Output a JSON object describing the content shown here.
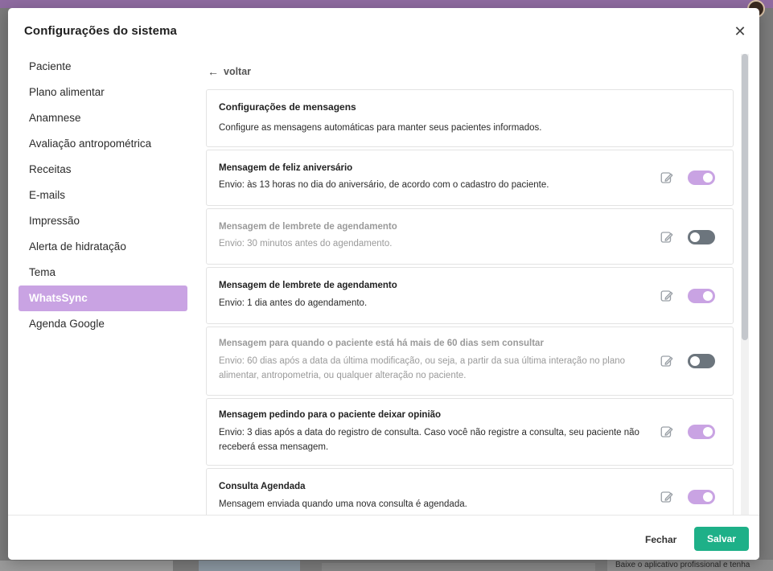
{
  "modal": {
    "title": "Configurações do sistema",
    "close_symbol": "✕"
  },
  "sidebar": {
    "items": [
      {
        "label": "Paciente"
      },
      {
        "label": "Plano alimentar"
      },
      {
        "label": "Anamnese"
      },
      {
        "label": "Avaliação antropométrica"
      },
      {
        "label": "Receitas"
      },
      {
        "label": "E-mails"
      },
      {
        "label": "Impressão"
      },
      {
        "label": "Alerta de hidratação"
      },
      {
        "label": "Tema"
      },
      {
        "label": "WhatsSync"
      },
      {
        "label": "Agenda Google"
      }
    ],
    "active_index": 9
  },
  "content": {
    "back_label": "voltar",
    "intro": {
      "title": "Configurações de mensagens",
      "description": "Configure as mensagens automáticas para manter seus pacientes informados."
    },
    "messages": [
      {
        "title": "Mensagem de feliz aniversário",
        "description": "Envio: às 13 horas no dia do aniversário, de acordo com o cadastro do paciente.",
        "enabled": true
      },
      {
        "title": "Mensagem de lembrete de agendamento",
        "description": "Envio: 30 minutos antes do agendamento.",
        "enabled": false
      },
      {
        "title": "Mensagem de lembrete de agendamento",
        "description": "Envio: 1 dia antes do agendamento.",
        "enabled": true
      },
      {
        "title": "Mensagem para quando o paciente está há mais de 60 dias sem consultar",
        "description": "Envio: 60 dias após a data da última modificação, ou seja, a partir da sua última interação no plano alimentar, antropometria, ou qualquer alteração no paciente.",
        "enabled": false
      },
      {
        "title": "Mensagem pedindo para o paciente deixar opinião",
        "description": "Envio: 3 dias após a data do registro de consulta. Caso você não registre a consulta, seu paciente não receberá essa mensagem.",
        "enabled": true
      },
      {
        "title": "Consulta Agendada",
        "description": "Mensagem enviada quando uma nova consulta é agendada.",
        "enabled": true
      }
    ]
  },
  "footer": {
    "close_label": "Fechar",
    "save_label": "Salvar"
  },
  "background": {
    "bottom_right_text": "Baixe o aplicativo profissional e tenha"
  },
  "colors": {
    "accent": "#c9a3e3",
    "toggle_off": "#6c757d",
    "save_button": "#1eb088"
  }
}
